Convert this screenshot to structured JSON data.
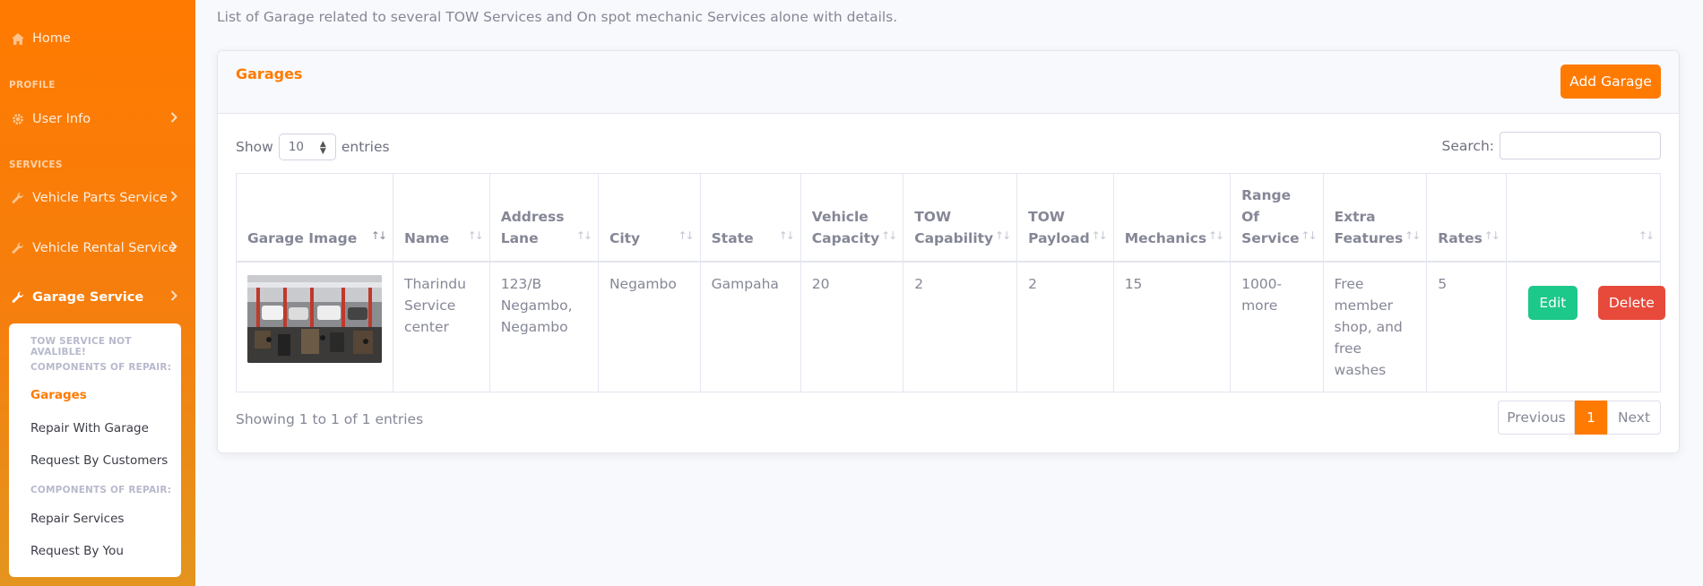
{
  "page": {
    "description": "List of Garage related to several TOW Services and On spot mechanic Services alone with details."
  },
  "sidebar": {
    "home": "Home",
    "profile_heading": "PROFILE",
    "user_info": "User Info",
    "services_heading": "SERVICES",
    "vehicle_parts": "Vehicle Parts Service",
    "vehicle_rental": "Vehicle Rental Service",
    "garage_service": "Garage Service",
    "submenu": {
      "heading_tow": "TOW SERVICE NOT AVALIBLE!",
      "heading_repair_1": "COMPONENTS OF REPAIR:",
      "garages": "Garages",
      "repair_with_garage": "Repair With Garage",
      "request_by_customers": "Request By Customers",
      "heading_repair_2": "COMPONENTS OF REPAIR:",
      "repair_services": "Repair Services",
      "request_by_you": "Request By You"
    }
  },
  "card": {
    "title": "Garages",
    "add_button": "Add Garage"
  },
  "datatable": {
    "show_label": "Show",
    "length_value": "10",
    "entries_label": "entries",
    "search_label": "Search:",
    "search_value": "",
    "columns": {
      "image": "Garage Image",
      "name": "Name",
      "address": "Address Lane",
      "city": "City",
      "state": "State",
      "capacity": "Vehicle Capacity",
      "tow_capability": "TOW Capability",
      "tow_payload": "TOW Payload",
      "mechanics": "Mechanics",
      "range": "Range Of Service",
      "extra": "Extra Features",
      "rates": "Rates"
    },
    "rows": [
      {
        "name": "Tharindu Service center",
        "address": "123/B Negambo, Negambo",
        "city": "Negambo",
        "state": "Gampaha",
        "capacity": "20",
        "tow_capability": "2",
        "tow_payload": "2",
        "mechanics": "15",
        "range": "1000-more",
        "extra": "Free member shop, and free washes",
        "rates": "5",
        "edit_label": "Edit",
        "delete_label": "Delete"
      }
    ],
    "info": "Showing 1 to 1 of 1 entries",
    "pagination": {
      "previous": "Previous",
      "current": "1",
      "next": "Next"
    }
  },
  "colors": {
    "accent": "#ff7a00",
    "success": "#1cc88a",
    "danger": "#e74a3b"
  }
}
